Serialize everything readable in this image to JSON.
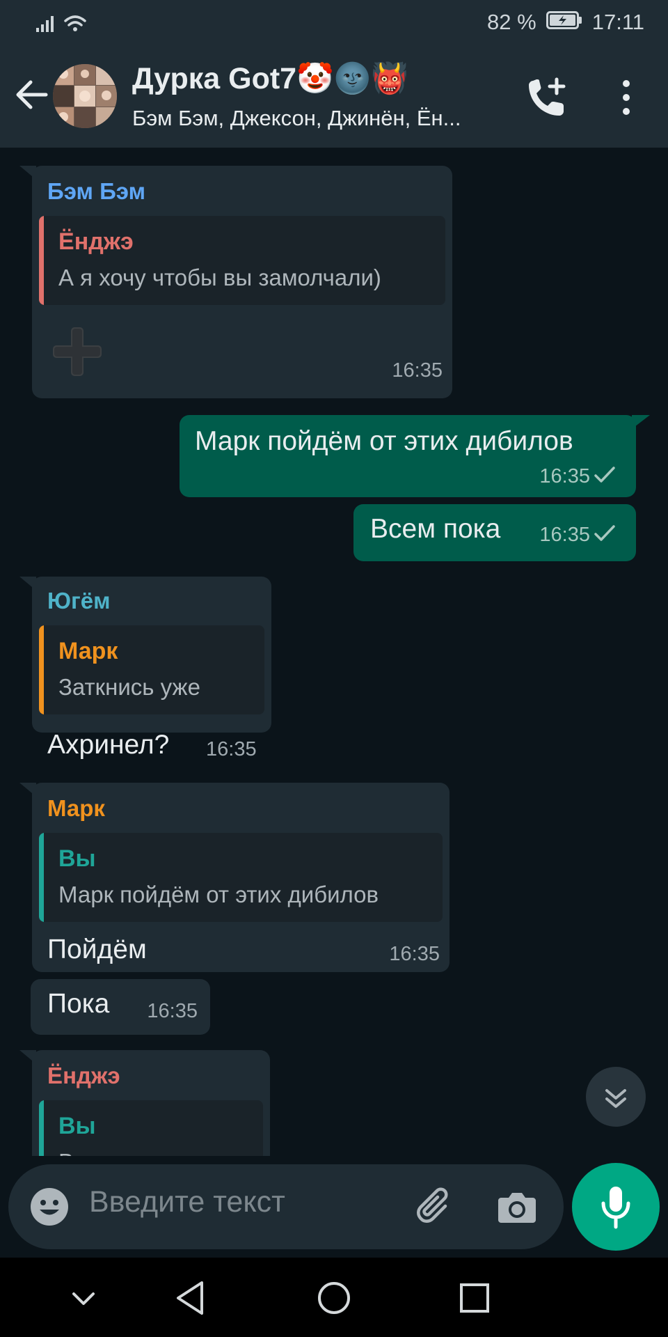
{
  "status_bar": {
    "battery": "82 %",
    "time": "17:11"
  },
  "header": {
    "title": "Дурка Got7🤡🌚👹",
    "subtitle": "Бэм Бэм, Джексон, Джинён, Ён..."
  },
  "colors": {
    "accent": "#00a884",
    "outgoing_bubble": "#005c4b",
    "incoming_bubble": "#1f2c34",
    "name_bambam": "#5fa6f5",
    "name_youngjae": "#e0716b",
    "name_yugyeom": "#4fb3c9",
    "name_mark": "#f0921e",
    "name_you": "#1fa598"
  },
  "messages": [
    {
      "sender": "Бэм Бэм",
      "quote_name": "Ёнджэ",
      "quote_text": "А я хочу чтобы вы замолчали)",
      "sticker": "plus-sticker",
      "time": "16:35"
    },
    {
      "outgoing": true,
      "text": "Марк пойдём от этих дибилов",
      "time": "16:35",
      "status": "sent"
    },
    {
      "outgoing": true,
      "text": "Всем пока",
      "time": "16:35",
      "status": "sent"
    },
    {
      "sender": "Югём",
      "quote_name": "Марк",
      "quote_text": "Заткнись уже",
      "text": "Ахринел?",
      "time": "16:35"
    },
    {
      "sender": "Марк",
      "quote_name": "Вы",
      "quote_text": "Марк пойдём от этих дибилов",
      "text": "Пойдём",
      "time": "16:35"
    },
    {
      "text": "Пока",
      "time": "16:35"
    },
    {
      "sender": "Ёнджэ",
      "quote_name": "Вы",
      "quote_text": "В"
    }
  ],
  "input": {
    "placeholder": "Введите текст"
  }
}
